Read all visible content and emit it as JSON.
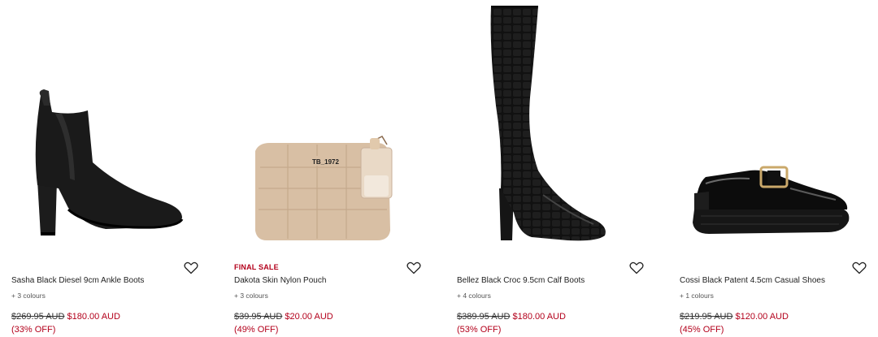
{
  "products": [
    {
      "name": "Sasha Black Diesel 9cm Ankle Boots",
      "badge": "",
      "colours": "+ 3 colours",
      "was_price": "$269.95 AUD",
      "now_price": "$180.00 AUD",
      "discount": "(33% OFF)",
      "image": "black-suede-ankle-boot"
    },
    {
      "name": "Dakota Skin Nylon Pouch",
      "badge": "FINAL SALE",
      "colours": "+ 3 colours",
      "was_price": "$39.95 AUD",
      "now_price": "$20.00 AUD",
      "discount": "(49% OFF)",
      "image": "beige-quilted-pouch",
      "image_text": "TB_1972"
    },
    {
      "name": "Bellez Black Croc 9.5cm Calf Boots",
      "badge": "",
      "colours": "+ 4 colours",
      "was_price": "$389.95 AUD",
      "now_price": "$180.00 AUD",
      "discount": "(53% OFF)",
      "image": "black-croc-knee-boot"
    },
    {
      "name": "Cossi Black Patent 4.5cm Casual Shoes",
      "badge": "",
      "colours": "+ 1 colours",
      "was_price": "$219.95 AUD",
      "now_price": "$120.00 AUD",
      "discount": "(45% OFF)",
      "image": "black-patent-loafer"
    }
  ],
  "icons": {
    "wishlist": "heart-outline-icon"
  },
  "colors": {
    "sale_red": "#b3001b",
    "text": "#222222"
  }
}
